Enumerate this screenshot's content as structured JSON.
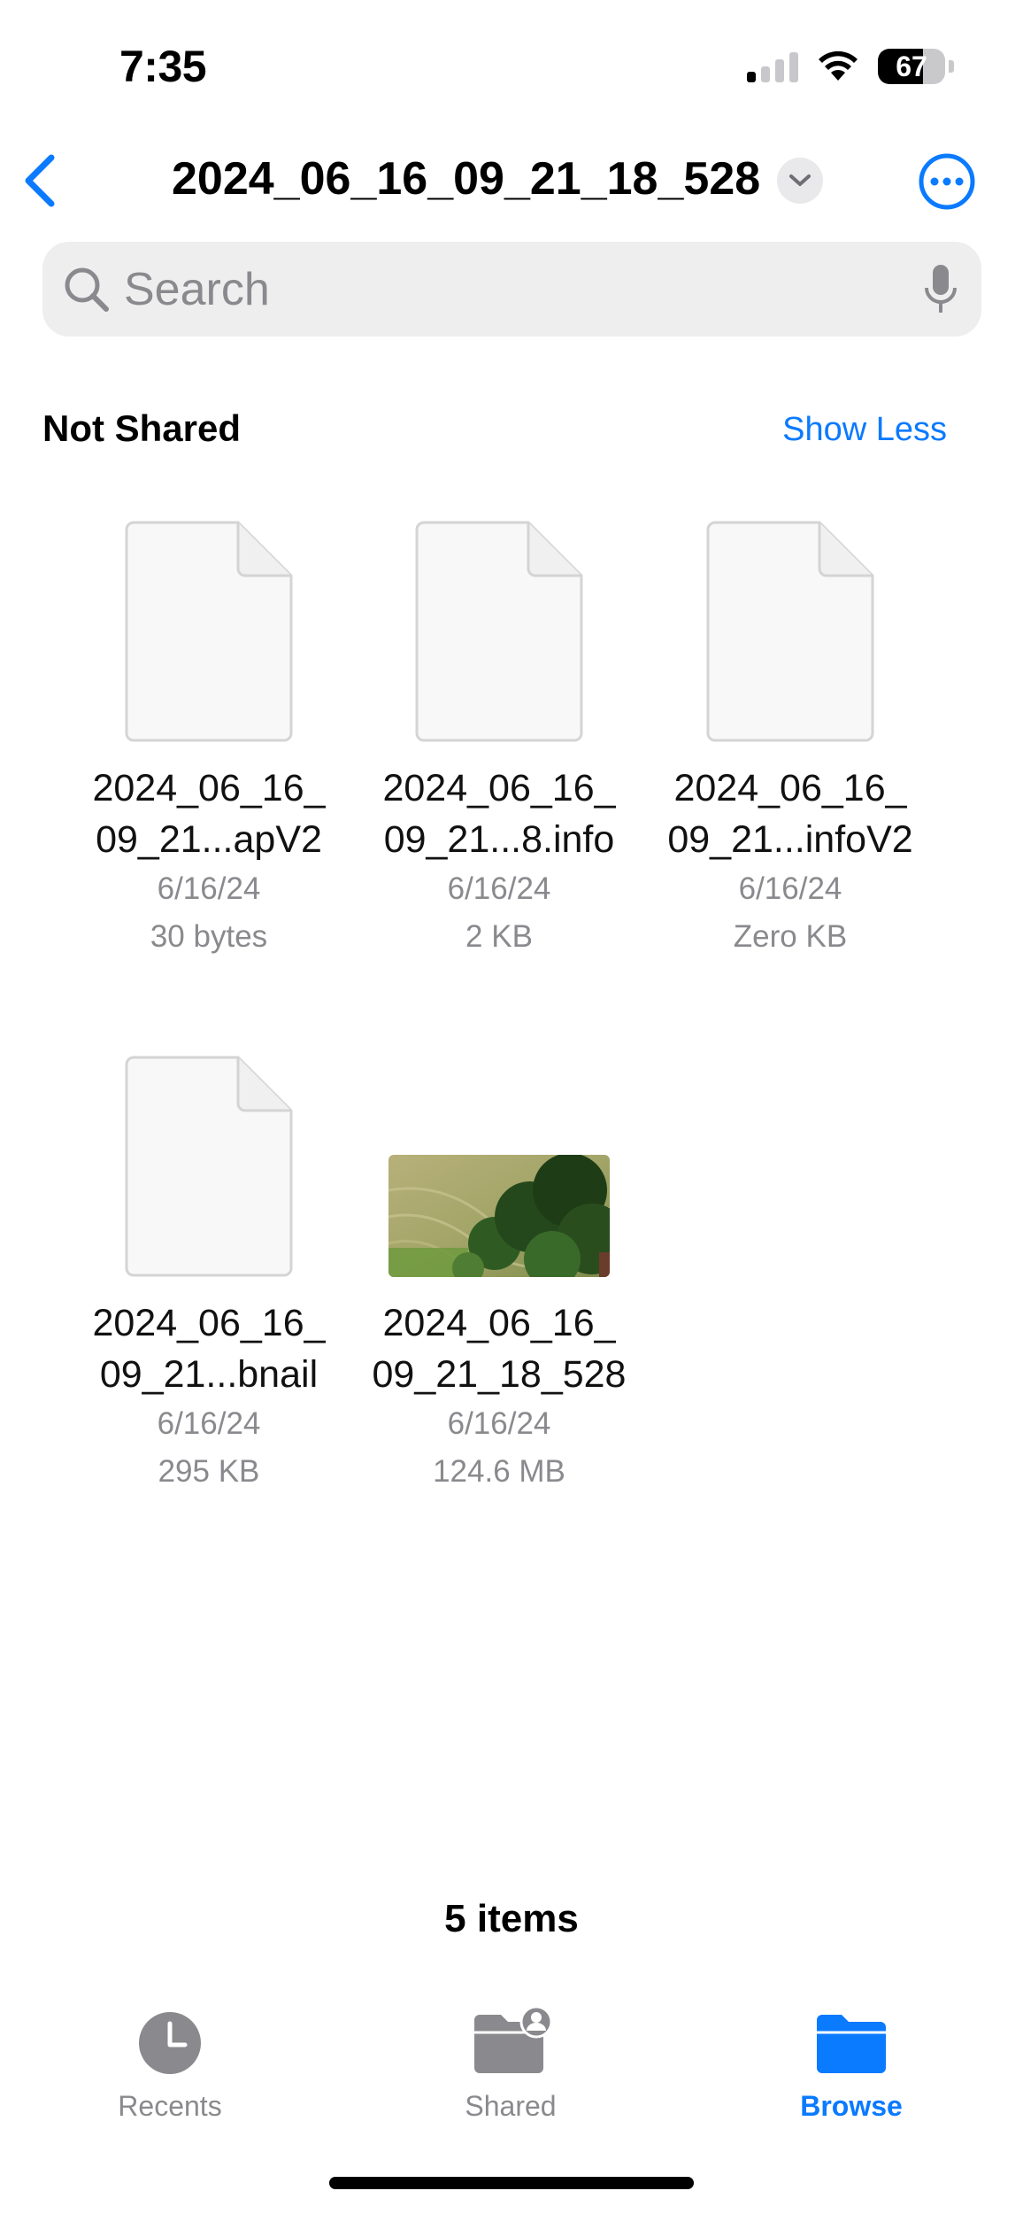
{
  "status_bar": {
    "time": "7:35",
    "battery_percent": "67",
    "battery_level": 0.67,
    "signal_bars_active": 1,
    "signal_bars_total": 4
  },
  "nav": {
    "title": "2024_06_16_09_21_18_528",
    "back_icon": "chevron-left-icon",
    "title_menu_icon": "chevron-down-icon",
    "more_icon": "ellipsis-circle-icon"
  },
  "search": {
    "placeholder": "Search",
    "value": ""
  },
  "section": {
    "title": "Not Shared",
    "action": "Show Less"
  },
  "files": [
    {
      "name_line1": "2024_06_16_",
      "name_line2": "09_21...apV2",
      "date": "6/16/24",
      "size": "30 bytes",
      "kind": "document"
    },
    {
      "name_line1": "2024_06_16_",
      "name_line2": "09_21...8.info",
      "date": "6/16/24",
      "size": "2 KB",
      "kind": "document"
    },
    {
      "name_line1": "2024_06_16_",
      "name_line2": "09_21...infoV2",
      "date": "6/16/24",
      "size": "Zero KB",
      "kind": "document"
    },
    {
      "name_line1": "2024_06_16_",
      "name_line2": "09_21...bnail",
      "date": "6/16/24",
      "size": "295 KB",
      "kind": "document"
    },
    {
      "name_line1": "2024_06_16_",
      "name_line2": "09_21_18_528",
      "date": "6/16/24",
      "size": "124.6 MB",
      "kind": "video"
    }
  ],
  "footer": {
    "item_count": "5 items"
  },
  "tabs": [
    {
      "label": "Recents",
      "icon": "clock-icon",
      "active": false
    },
    {
      "label": "Shared",
      "icon": "shared-folder-icon",
      "active": false
    },
    {
      "label": "Browse",
      "icon": "folder-icon",
      "active": true
    }
  ],
  "colors": {
    "accent": "#0a7aff",
    "secondary_text": "#8a8a8e",
    "search_bg": "#eeeeef"
  }
}
